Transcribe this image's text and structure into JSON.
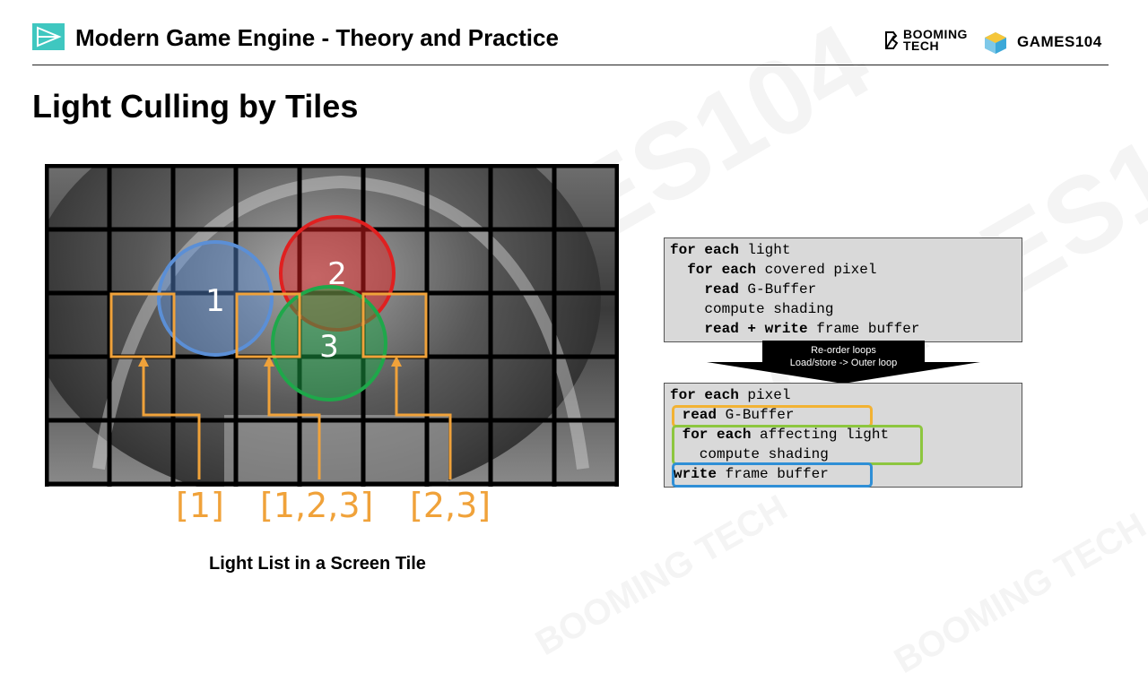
{
  "header": {
    "course_title": "Modern Game Engine - Theory and Practice",
    "brand_booming_line1": "BOOMING",
    "brand_booming_line2": "TECH",
    "brand_games": "GAMES104"
  },
  "slide": {
    "title": "Light Culling by Tiles",
    "caption": "Light List in a Screen Tile"
  },
  "diagram": {
    "lights": [
      {
        "label": "1",
        "color": "#5b8fd6"
      },
      {
        "label": "2",
        "color": "#e02020"
      },
      {
        "label": "3",
        "color": "#1ea84a"
      }
    ],
    "tile_lists": [
      "[1]",
      "[1,2,3]",
      "[2,3]"
    ],
    "tile_highlight_color": "#f0a23a"
  },
  "code_before": {
    "lines": [
      {
        "kw": "for each",
        "rest": " light"
      },
      {
        "kw": "  for each",
        "rest": " covered pixel"
      },
      {
        "kw": "    read",
        "rest": " G-Buffer"
      },
      {
        "kw": "",
        "rest": "    compute shading"
      },
      {
        "kw": "    read + write",
        "rest": " frame buffer"
      }
    ]
  },
  "arrow": {
    "line1": "Re-order loops",
    "line2": "Load/store -> Outer loop"
  },
  "code_after": {
    "lines": [
      {
        "kw": "for each",
        "rest": " pixel"
      },
      {
        "kw": " read",
        "rest": " G-Buffer"
      },
      {
        "kw": " for each",
        "rest": " affecting light"
      },
      {
        "kw": "",
        "rest": "   compute shading"
      },
      {
        "kw": "write",
        "rest": " frame buffer"
      }
    ],
    "highlight_colors": {
      "read": "#f2b233",
      "loop": "#8dc63f",
      "write": "#2f8fd6"
    }
  },
  "watermarks": [
    "GAMES104",
    "BOOMING TECH"
  ]
}
